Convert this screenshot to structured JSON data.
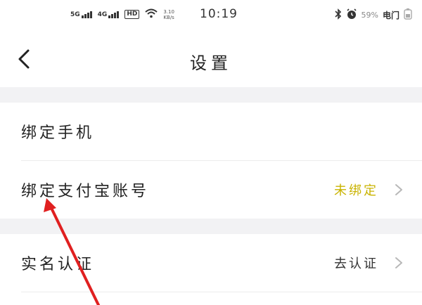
{
  "status_bar": {
    "sim1_label": "5G",
    "sim2_label": "4G",
    "hd_label": "HD",
    "net_speed_value": "3.10",
    "net_speed_unit": "KB/s",
    "time": "10:19",
    "battery_text": "59%",
    "carrier_text": "电门"
  },
  "nav": {
    "title": "设置"
  },
  "rows": [
    {
      "label": "绑定手机",
      "value": ""
    },
    {
      "label": "绑定支付宝账号",
      "value": "未绑定"
    },
    {
      "label": "实名认证",
      "value": "去认证"
    }
  ],
  "colors": {
    "value_unbound": "#c9b300",
    "value_default": "#333333",
    "gap_background": "#f2f2f4",
    "annotation_arrow": "#e02020"
  },
  "icons": {
    "back": "chevron-left-icon",
    "row_arrow": "chevron-right-icon",
    "bluetooth": "bluetooth-icon",
    "alarm": "alarm-icon",
    "wifi": "wifi-icon",
    "battery": "battery-icon"
  }
}
